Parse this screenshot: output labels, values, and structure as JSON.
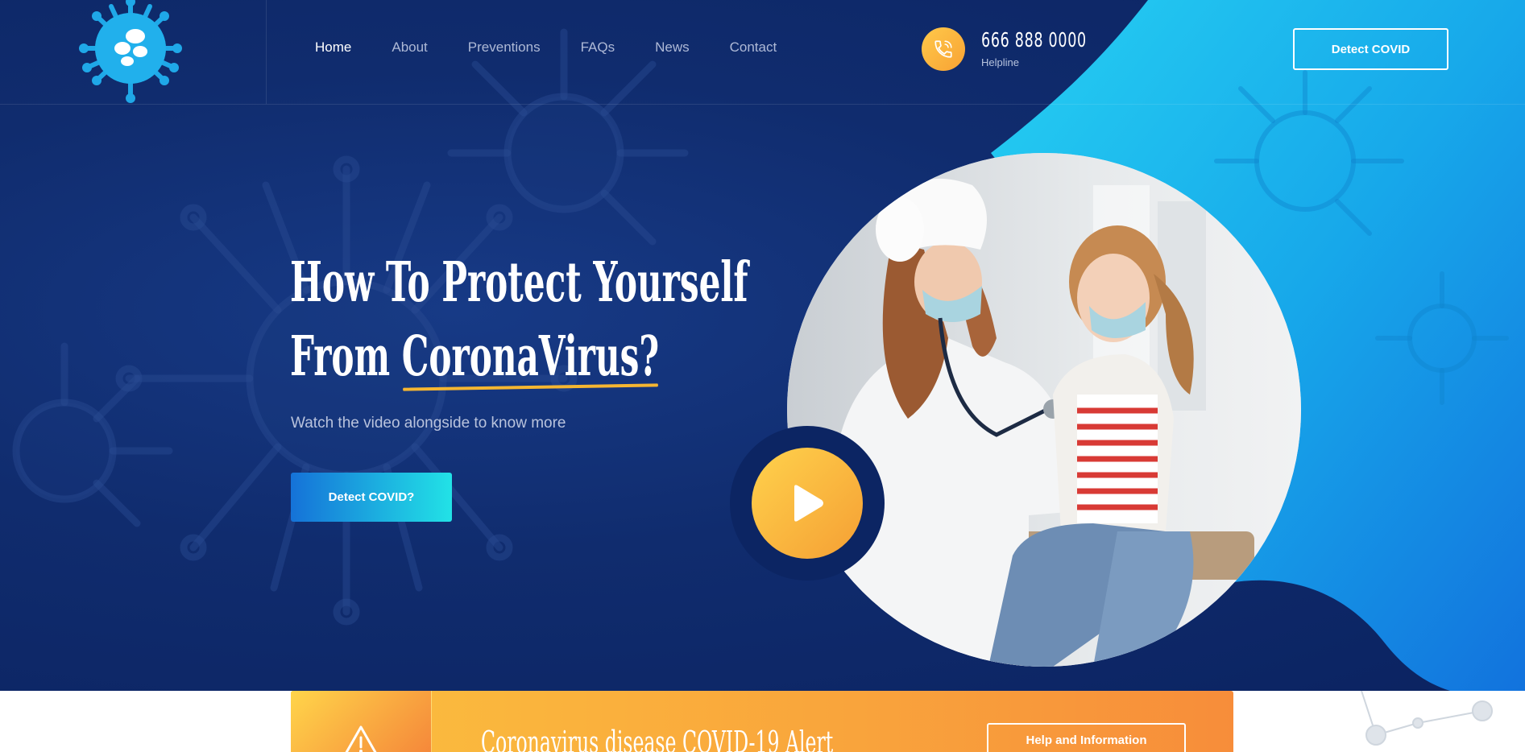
{
  "header": {
    "nav": [
      {
        "label": "Home",
        "active": true
      },
      {
        "label": "About",
        "active": false
      },
      {
        "label": "Preventions",
        "active": false
      },
      {
        "label": "FAQs",
        "active": false
      },
      {
        "label": "News",
        "active": false
      },
      {
        "label": "Contact",
        "active": false
      }
    ],
    "phone_number": "666 888 0000",
    "phone_label": "Helpline",
    "detect_button": "Detect COVID"
  },
  "hero": {
    "title_line1": "How To Protect Yourself",
    "title_line2_prefix": "From ",
    "title_line2_highlight": "CoronaVirus?",
    "subtitle": "Watch the video alongside to know more",
    "cta_label": "Detect COVID?"
  },
  "alert": {
    "text": "Coronavirus disease COVID-19 Alert",
    "button_label": "Help and Information"
  },
  "colors": {
    "hero_bg": "#102c6e",
    "accent_cyan": "#1fc3ef",
    "accent_orange": "#f9a43c",
    "accent_yellow": "#ffd24c"
  },
  "icons": {
    "logo": "virus-logo-icon",
    "phone": "phone-icon",
    "play": "play-icon",
    "warning": "warning-icon"
  }
}
